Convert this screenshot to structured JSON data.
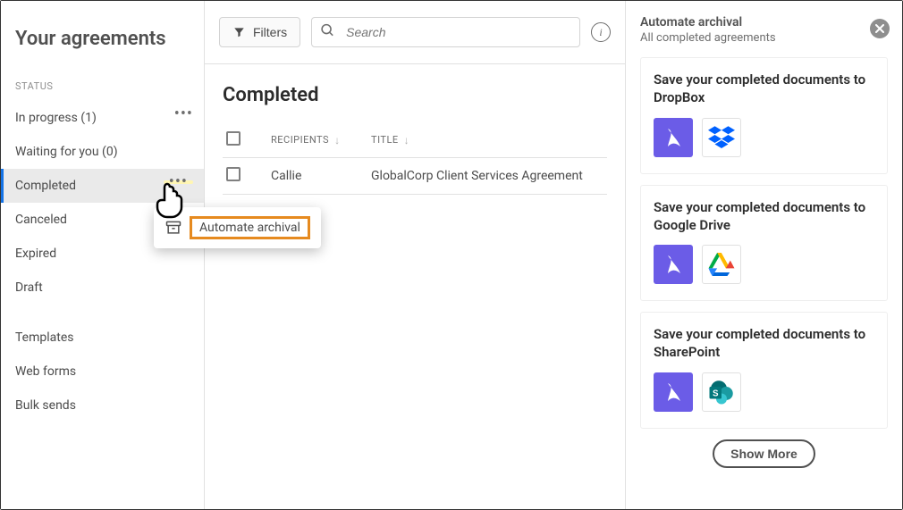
{
  "header": {
    "page_title": "Your agreements",
    "filters_label": "Filters",
    "search_placeholder": "Search",
    "info_label": "i"
  },
  "sidebar": {
    "section_label": "STATUS",
    "items": [
      {
        "label": "In progress (1)",
        "has_more": true,
        "active": false
      },
      {
        "label": "Waiting for you (0)",
        "has_more": false,
        "active": false
      },
      {
        "label": "Completed",
        "has_more": true,
        "active": true
      },
      {
        "label": "Canceled",
        "has_more": false,
        "active": false
      },
      {
        "label": "Expired",
        "has_more": false,
        "active": false
      },
      {
        "label": "Draft",
        "has_more": false,
        "active": false
      }
    ],
    "secondary": [
      {
        "label": "Templates"
      },
      {
        "label": "Web forms"
      },
      {
        "label": "Bulk sends"
      }
    ]
  },
  "tooltip": {
    "label": "Automate archival"
  },
  "main": {
    "title": "Completed",
    "columns": {
      "recipients": "RECIPIENTS",
      "title": "TITLE"
    },
    "rows": [
      {
        "recipient": "Callie",
        "title": "GlobalCorp Client Services Agreement"
      }
    ]
  },
  "panel": {
    "title": "Automate archival",
    "subtitle": "All completed agreements",
    "cards": [
      {
        "title": "Save your completed documents to DropBox",
        "service": "dropbox"
      },
      {
        "title": "Save your completed documents to Google Drive",
        "service": "gdrive"
      },
      {
        "title": "Save your completed documents to SharePoint",
        "service": "sharepoint"
      }
    ],
    "show_more": "Show More"
  }
}
